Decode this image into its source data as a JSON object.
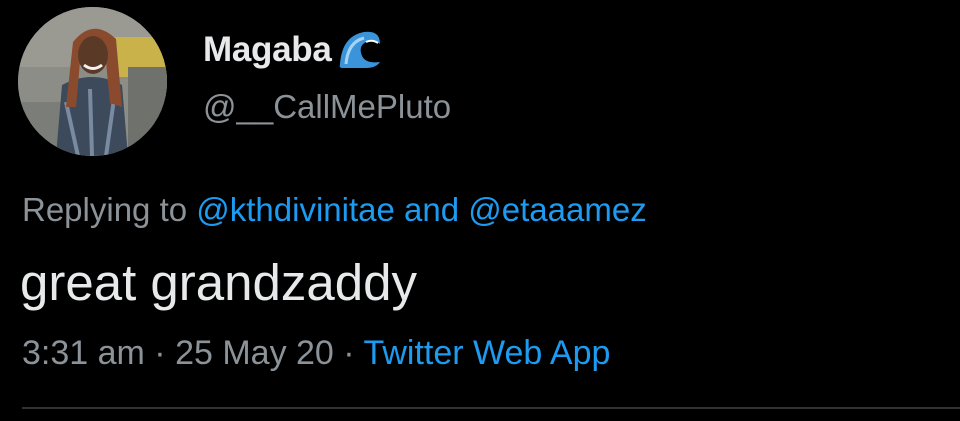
{
  "author": {
    "display_name": "Magaba",
    "name_emoji": "wave-icon",
    "handle": "@__CallMePluto",
    "avatar": "avatar-photo"
  },
  "reply": {
    "prefix": "Replying to ",
    "mention_1": "@kthdivinitae",
    "conjunction": " and ",
    "mention_2": "@etaaamez"
  },
  "tweet": {
    "text": "great grandzaddy"
  },
  "meta": {
    "time": "3:31 am",
    "sep_1": " · ",
    "date": "25 May 20",
    "sep_2": " · ",
    "source": "Twitter Web App"
  },
  "colors": {
    "background": "#000000",
    "primary_text": "#e7e9ea",
    "secondary_text": "#8b9399",
    "link": "#1d9bf0",
    "divider": "#2f3336"
  }
}
